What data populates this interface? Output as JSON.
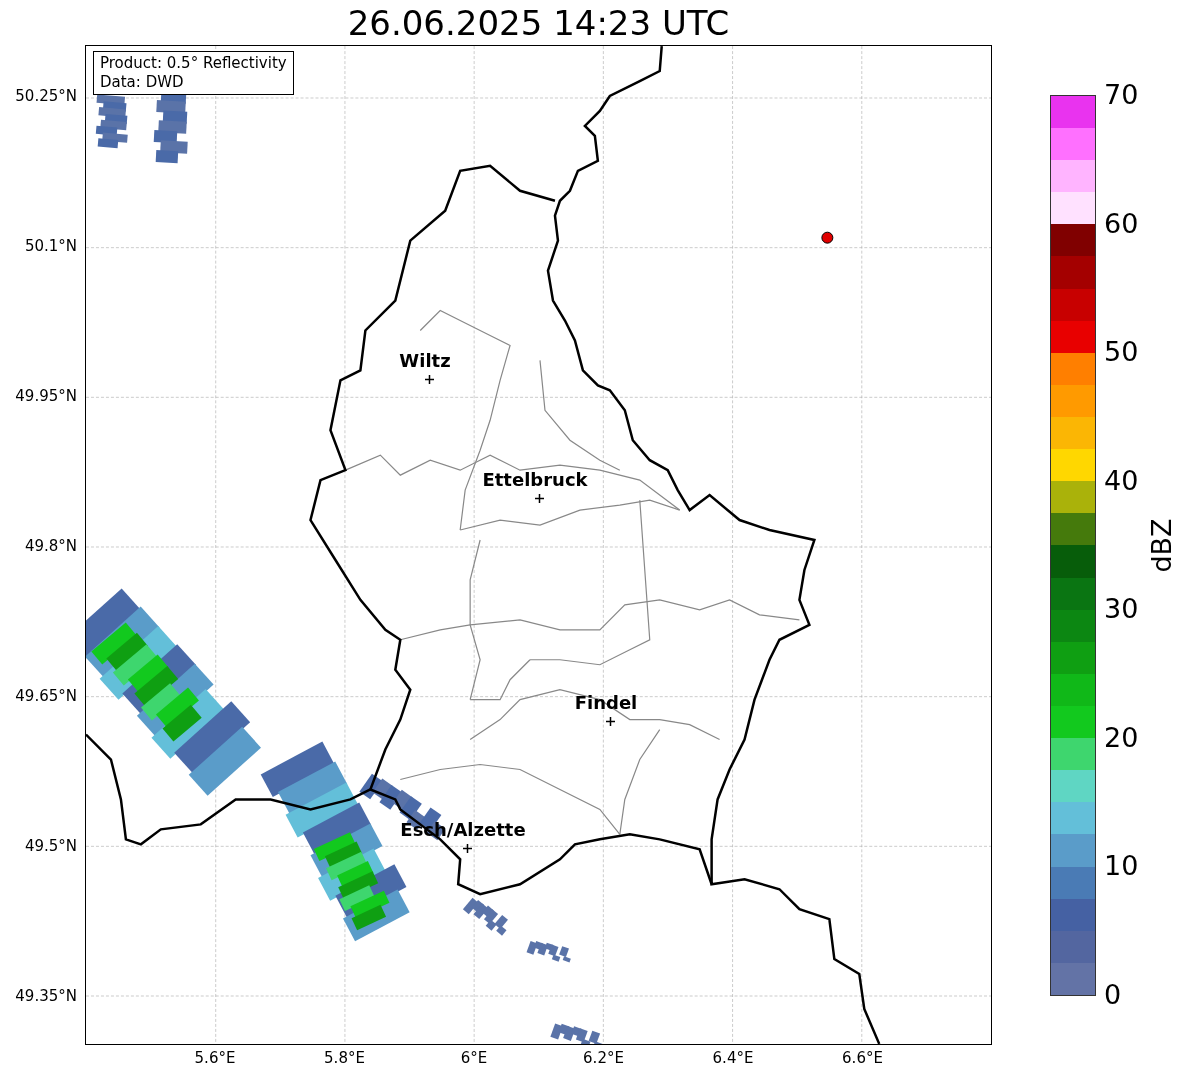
{
  "title": "26.06.2025 14:23 UTC",
  "info_box": [
    "Product: 0.5° Reflectivity",
    "Data: DWD"
  ],
  "y_ticks": [
    "50.25°N",
    "50.1°N",
    "49.95°N",
    "49.8°N",
    "49.65°N",
    "49.5°N",
    "49.35°N"
  ],
  "x_ticks": [
    "5.6°E",
    "5.8°E",
    "6°E",
    "6.2°E",
    "6.4°E",
    "6.6°E"
  ],
  "places": [
    {
      "name": "Wiltz"
    },
    {
      "name": "Ettelbruck"
    },
    {
      "name": "Findel"
    },
    {
      "name": "Esch/Alzette"
    }
  ],
  "colorbar": {
    "label": "dBZ",
    "ticks": [
      "70",
      "60",
      "50",
      "40",
      "30",
      "20",
      "10",
      "0"
    ],
    "segments": [
      {
        "color": "#6373a6"
      },
      {
        "color": "#5366a0"
      },
      {
        "color": "#4561a3"
      },
      {
        "color": "#4a7bb5"
      },
      {
        "color": "#5a9cc9"
      },
      {
        "color": "#63bfd9"
      },
      {
        "color": "#5fd6c3"
      },
      {
        "color": "#3ed66e"
      },
      {
        "color": "#12c91e"
      },
      {
        "color": "#10b818"
      },
      {
        "color": "#0f9f12"
      },
      {
        "color": "#0c8712"
      },
      {
        "color": "#0a7512"
      },
      {
        "color": "#075d0a"
      },
      {
        "color": "#457a0c"
      },
      {
        "color": "#aab20a"
      },
      {
        "color": "#ffd700"
      },
      {
        "color": "#fbb604"
      },
      {
        "color": "#ff9a00"
      },
      {
        "color": "#ff7f00"
      },
      {
        "color": "#e80000"
      },
      {
        "color": "#c80000"
      },
      {
        "color": "#a40000"
      },
      {
        "color": "#800000"
      },
      {
        "color": "#ffe1ff"
      },
      {
        "color": "#ffb4ff"
      },
      {
        "color": "#ff70ff"
      },
      {
        "color": "#e933ef"
      }
    ]
  }
}
